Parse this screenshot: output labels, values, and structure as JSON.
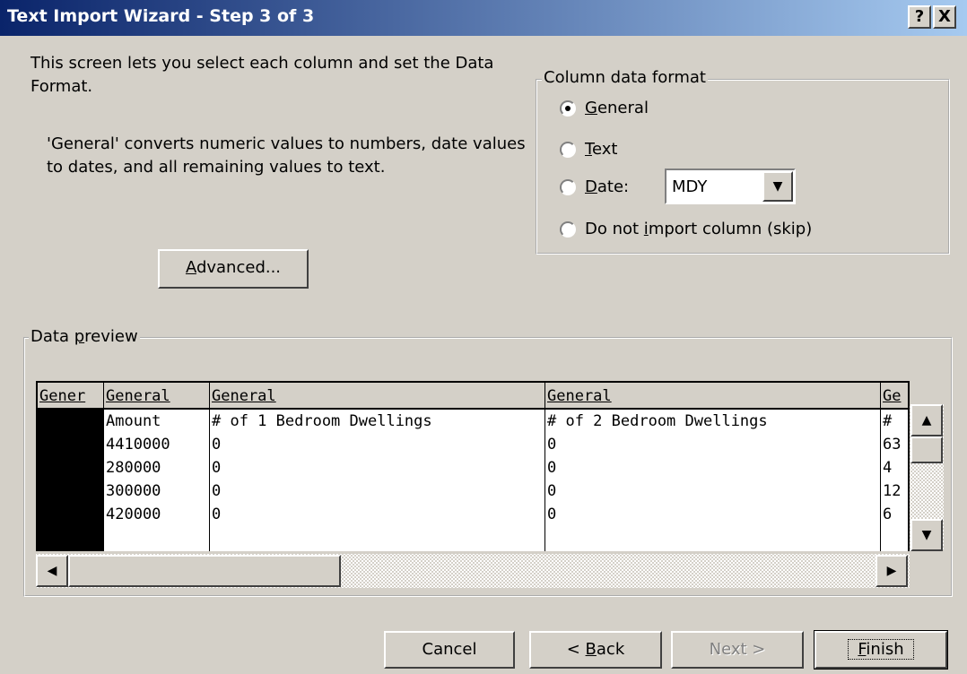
{
  "window": {
    "title": "Text Import Wizard - Step 3 of 3",
    "help_label": "?",
    "close_label": "X"
  },
  "intro": {
    "text": "This screen lets you select each column and set the Data Format.",
    "description": "'General' converts numeric values to numbers, date values to dates, and all remaining values to text."
  },
  "advanced_button": {
    "prefix": "",
    "mnemonic": "A",
    "suffix": "dvanced..."
  },
  "column_format": {
    "legend": "Column data format",
    "options": [
      {
        "mnemonic": "G",
        "rest": "eneral",
        "prefix": "",
        "checked": true
      },
      {
        "mnemonic": "T",
        "rest": "ext",
        "prefix": "",
        "checked": false
      },
      {
        "mnemonic": "D",
        "rest": "ate:",
        "prefix": "",
        "checked": false
      },
      {
        "prefix": "Do not ",
        "mnemonic": "i",
        "rest": "mport column (skip)",
        "checked": false
      }
    ],
    "date_format": "MDY"
  },
  "preview": {
    "legend_prefix": "Data ",
    "legend_mnemonic": "p",
    "legend_suffix": "review",
    "columns": [
      {
        "header": "Gener",
        "cells": [
          "",
          "",
          "",
          "",
          ""
        ],
        "selected": true
      },
      {
        "header": "General",
        "cells": [
          "Amount",
          "4410000",
          "280000",
          "300000",
          "420000"
        ],
        "selected": false
      },
      {
        "header": "General",
        "cells": [
          "# of 1 Bedroom Dwellings",
          "0",
          "0",
          "0",
          "0"
        ],
        "selected": false
      },
      {
        "header": "General",
        "cells": [
          "# of 2 Bedroom Dwellings",
          "0",
          "0",
          "0",
          "0"
        ],
        "selected": false
      },
      {
        "header": "Ge",
        "cells": [
          "#",
          "63",
          "4",
          "12",
          "6"
        ],
        "selected": false
      }
    ]
  },
  "buttons": {
    "cancel": "Cancel",
    "back_prefix": "< ",
    "back_mnemonic": "B",
    "back_rest": "ack",
    "next": "Next >",
    "finish_mnemonic": "F",
    "finish_rest": "inish"
  }
}
